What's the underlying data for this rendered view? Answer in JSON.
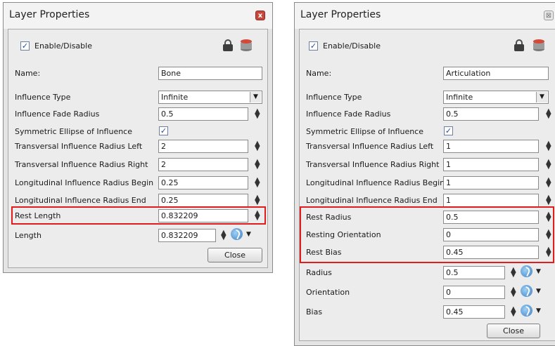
{
  "left": {
    "title": "Layer Properties",
    "close_glyph": "x",
    "enable_label": "Enable/Disable",
    "name_label": "Name:",
    "name_value": "Bone",
    "fields": [
      {
        "label": "Influence Type",
        "value": "Infinite",
        "kind": "dropdown"
      },
      {
        "label": "Influence Fade Radius",
        "value": "0.5",
        "kind": "spin"
      },
      {
        "label": "Symmetric Ellipse of Influence",
        "value": "",
        "kind": "check"
      },
      {
        "label": "Transversal Influence Radius Left",
        "value": "2",
        "kind": "spin"
      },
      {
        "label": "Transversal Influence Radius Right",
        "value": "2",
        "kind": "spin"
      },
      {
        "label": "Longitudinal Influence Radius Begin",
        "value": "0.25",
        "kind": "spin"
      },
      {
        "label": "Longitudinal Influence Radius End",
        "value": "0.25",
        "kind": "spin"
      },
      {
        "label": "Rest Length",
        "value": "0.832209",
        "kind": "spin"
      },
      {
        "label": "Length",
        "value": "0.832209",
        "kind": "fn"
      }
    ],
    "close_button": "Close"
  },
  "right": {
    "title": "Layer Properties",
    "close_glyph": "⊠",
    "enable_label": "Enable/Disable",
    "name_label": "Name:",
    "name_value": "Articulation",
    "fields": [
      {
        "label": "Influence Type",
        "value": "Infinite",
        "kind": "dropdown"
      },
      {
        "label": "Influence Fade Radius",
        "value": "0.5",
        "kind": "spin"
      },
      {
        "label": "Symmetric Ellipse of Influence",
        "value": "",
        "kind": "check"
      },
      {
        "label": "Transversal Influence Radius Left",
        "value": "1",
        "kind": "spin"
      },
      {
        "label": "Transversal Influence Radius Right",
        "value": "1",
        "kind": "spin"
      },
      {
        "label": "Longitudinal Influence Radius Begin",
        "value": "1",
        "kind": "spin"
      },
      {
        "label": "Longitudinal Influence Radius End",
        "value": "1",
        "kind": "spin"
      },
      {
        "label": "Rest Radius",
        "value": "0.5",
        "kind": "spin"
      },
      {
        "label": "Resting Orientation",
        "value": "0",
        "kind": "spin"
      },
      {
        "label": "Rest Bias",
        "value": "0.45",
        "kind": "spin"
      },
      {
        "label": "Radius",
        "value": "0.5",
        "kind": "fn"
      },
      {
        "label": "Orientation",
        "value": "0",
        "kind": "fn"
      },
      {
        "label": "Bias",
        "value": "0.45",
        "kind": "fn"
      }
    ],
    "close_button": "Close"
  },
  "icons": {
    "checkmark": "✓",
    "dropdown_arrow": "▼",
    "spin_up": "▲",
    "spin_down": "▼",
    "menu_caret": "▼"
  },
  "colors": {
    "highlight": "#e01c1c",
    "function_icon": "#3a7fc2",
    "close_red": "#c9463d"
  }
}
